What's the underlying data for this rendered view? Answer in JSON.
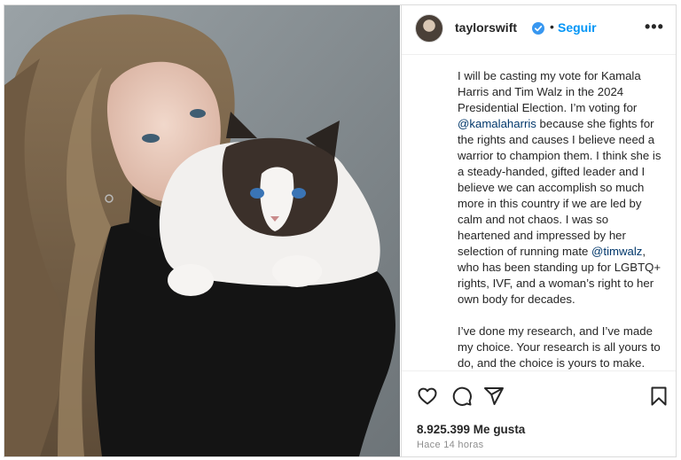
{
  "post": {
    "username": "taylorswift",
    "follow_label": "Seguir",
    "separator": "•",
    "more_label": "•••",
    "caption_p1_a": "I will be casting my vote for Kamala Harris and Tim Walz in the 2024 Presidential Election. I’m voting for ",
    "mention_1": "@kamalaharris",
    "caption_p1_b": " because she fights for the rights and causes I believe need a warrior to champion them. I think she is a steady-handed, gifted leader and I believe we can accomplish so much more in this country if we are led by calm and not chaos. I was so heartened and impressed by her selection of running mate ",
    "mention_2": "@timwalz",
    "caption_p1_c": ", who has been standing up for LGBTQ+ rights, IVF, and a woman’s right to her own body for decades.",
    "caption_p2": "I’ve done my research, and I’ve made my choice. Your research is all yours to do, and the choice is yours to make.",
    "likes": "8.925.399 Me gusta",
    "time": "Hace 14 horas"
  },
  "colors": {
    "accent": "#0095f6",
    "verified": "#3897f0",
    "mention": "#00376b",
    "text": "#262626",
    "muted": "#8e8e8e"
  },
  "icons": [
    "heart-icon",
    "comment-icon",
    "share-icon",
    "bookmark-icon",
    "verified-badge-icon",
    "more-options-icon"
  ]
}
